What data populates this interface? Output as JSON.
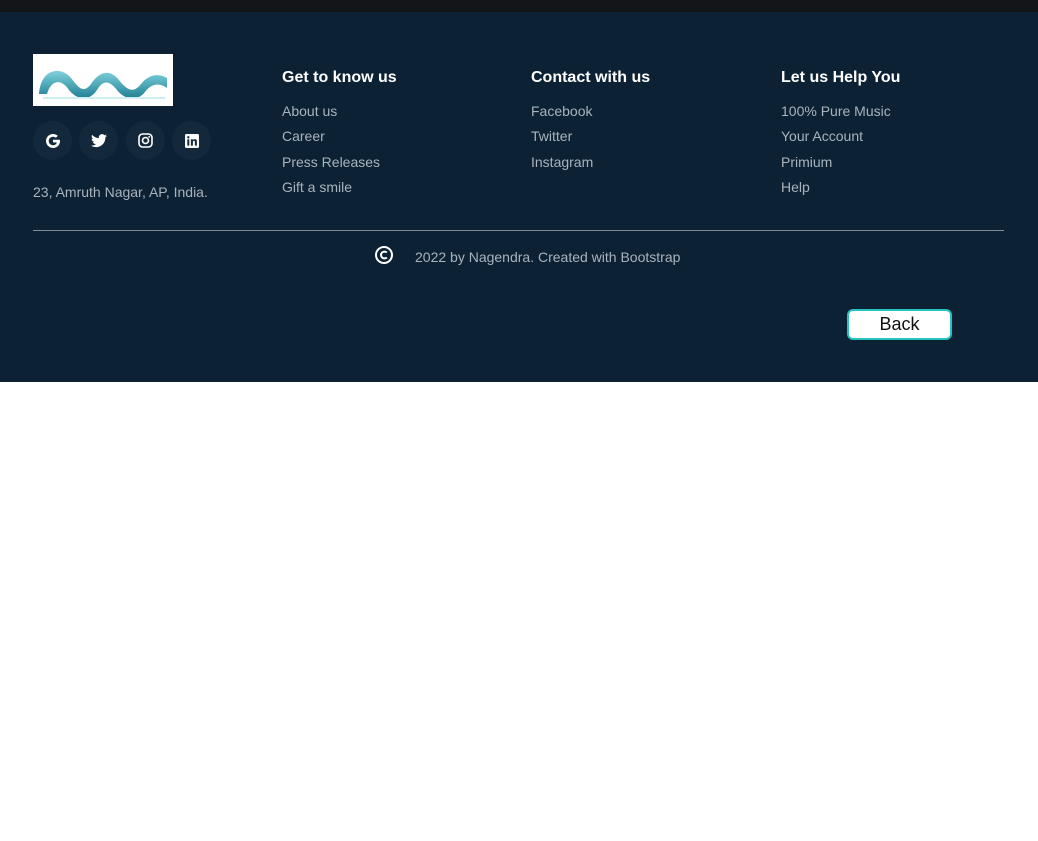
{
  "footer": {
    "address": "23, Amruth Nagar, AP, India.",
    "social": [
      {
        "icon": "google-icon"
      },
      {
        "icon": "twitter-icon"
      },
      {
        "icon": "instagram-icon"
      },
      {
        "icon": "linkedin-icon"
      }
    ],
    "columns": [
      {
        "title": "Get to know us",
        "links": [
          "About us",
          "Career",
          "Press Releases",
          "Gift a smile"
        ]
      },
      {
        "title": "Contact with us",
        "links": [
          "Facebook",
          "Twitter",
          "Instagram"
        ]
      },
      {
        "title": "Let us Help You",
        "links": [
          "100% Pure Music",
          "Your Account",
          "Primium",
          "Help"
        ]
      }
    ],
    "copyright": "2022 by Nagendra. Created with Bootstrap",
    "back_label": "Back"
  },
  "colors": {
    "footer_bg": "#0c2234",
    "top_bar": "#131518",
    "link_text": "#a9b3bd",
    "heading_text": "#ffffff",
    "back_button_border": "#25c2c0",
    "logo_accent": "#3aa9b8"
  }
}
